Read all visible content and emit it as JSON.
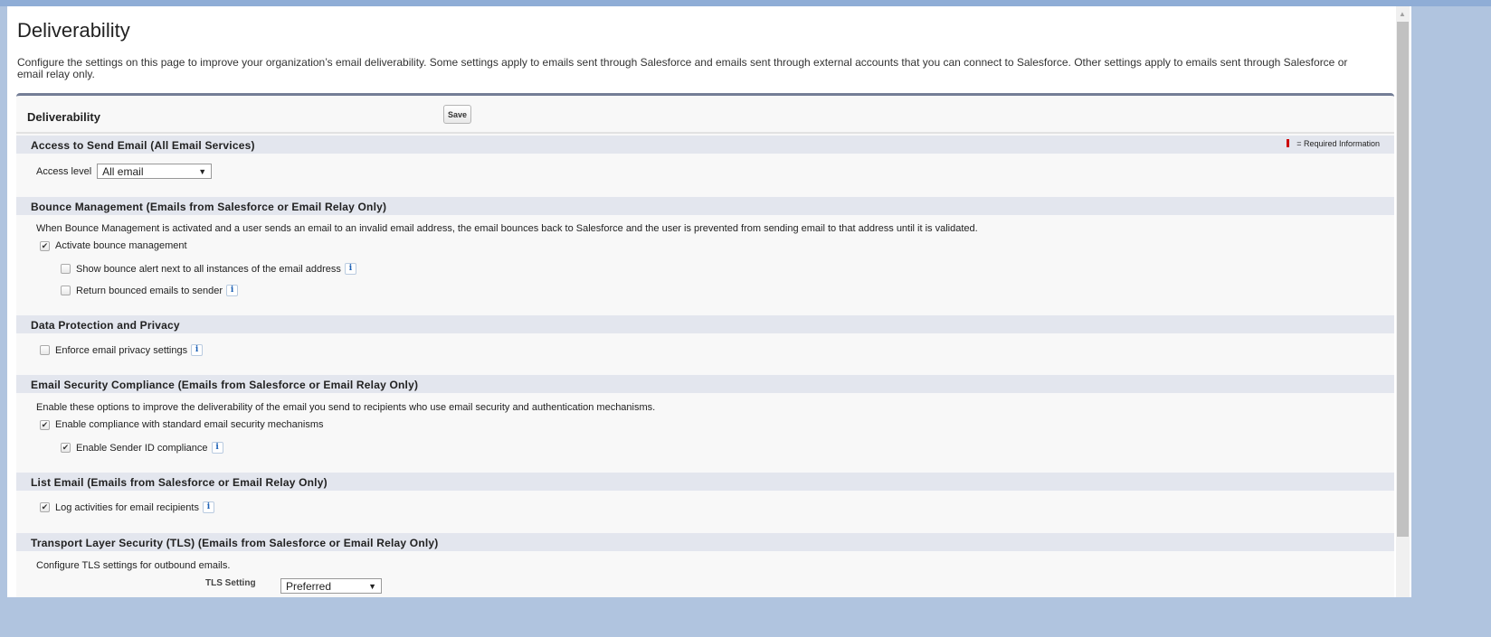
{
  "page": {
    "title": "Deliverability",
    "description": "Configure the settings on this page to improve your organization’s email deliverability. Some settings apply to emails sent through Salesforce and emails sent through external accounts that you can connect to Salesforce. Other settings apply to emails sent through Salesforce or email relay only."
  },
  "panel": {
    "title": "Deliverability",
    "save_label": "Save",
    "required_info": "= Required Information",
    "required_color": "#cc0000"
  },
  "access": {
    "header": "Access to Send Email (All Email Services)",
    "label": "Access level",
    "value": "All email"
  },
  "bounce": {
    "header": "Bounce Management (Emails from Salesforce or Email Relay Only)",
    "description": "When Bounce Management is activated and a user sends an email to an invalid email address, the email bounces back to Salesforce and the user is prevented from sending email to that address until it is validated.",
    "items": [
      {
        "label": "Activate bounce management",
        "checked": true
      },
      {
        "label": "Show bounce alert next to all instances of the email address",
        "checked": false
      },
      {
        "label": "Return bounced emails to sender",
        "checked": false
      }
    ]
  },
  "privacy": {
    "header": "Data Protection and Privacy",
    "items": [
      {
        "label": "Enforce email privacy settings",
        "checked": false
      }
    ]
  },
  "security": {
    "header": "Email Security Compliance (Emails from Salesforce or Email Relay Only)",
    "description": "Enable these options to improve the deliverability of the email you send to recipients who use email security and authentication mechanisms.",
    "items": [
      {
        "label": "Enable compliance with standard email security mechanisms",
        "checked": true
      },
      {
        "label": "Enable Sender ID compliance",
        "checked": true
      }
    ]
  },
  "list_email": {
    "header": "List Email (Emails from Salesforce or Email Relay Only)",
    "items": [
      {
        "label": "Log activities for email recipients",
        "checked": true
      }
    ]
  },
  "tls": {
    "header": "Transport Layer Security (TLS) (Emails from Salesforce or Email Relay Only)",
    "description": "Configure TLS settings for outbound emails.",
    "label": "TLS Setting",
    "value": "Preferred"
  },
  "icons": {
    "check": "✔",
    "info": "i",
    "dropdown": "▼"
  }
}
